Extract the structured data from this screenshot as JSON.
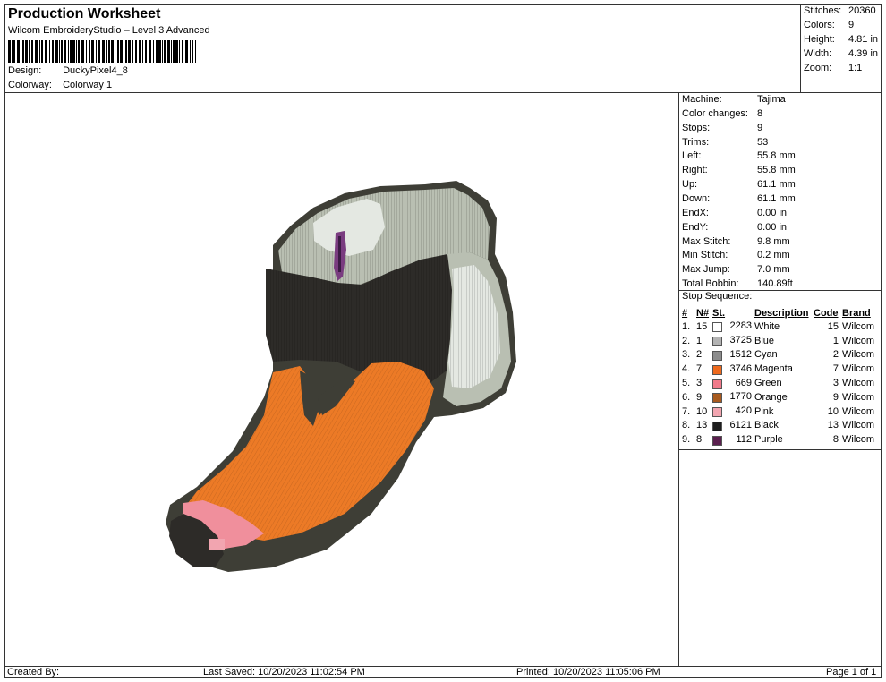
{
  "header": {
    "title": "Production Worksheet",
    "subtitle": "Wilcom EmbroideryStudio – Level 3 Advanced",
    "design_label": "Design:",
    "design_value": "DuckyPixel4_8",
    "colorway_label": "Colorway:",
    "colorway_value": "Colorway 1"
  },
  "stats": [
    {
      "k": "Stitches:",
      "v": "20360"
    },
    {
      "k": "Colors:",
      "v": "9"
    },
    {
      "k": "Height:",
      "v": "4.81 in"
    },
    {
      "k": "Width:",
      "v": "4.39 in"
    },
    {
      "k": "Zoom:",
      "v": "1:1"
    }
  ],
  "machine_info": [
    {
      "k": "Machine:",
      "v": "Tajima"
    },
    {
      "k": "Color changes:",
      "v": "8"
    },
    {
      "k": "Stops:",
      "v": "9"
    },
    {
      "k": "Trims:",
      "v": "53"
    },
    {
      "k": "Left:",
      "v": "55.8 mm"
    },
    {
      "k": "Right:",
      "v": "55.8 mm"
    },
    {
      "k": "Up:",
      "v": "61.1 mm"
    },
    {
      "k": "Down:",
      "v": "61.1 mm"
    },
    {
      "k": "EndX:",
      "v": "0.00 in"
    },
    {
      "k": "EndY:",
      "v": "0.00 in"
    },
    {
      "k": "Max Stitch:",
      "v": "9.8 mm"
    },
    {
      "k": "Min Stitch:",
      "v": "0.2 mm"
    },
    {
      "k": "Max Jump:",
      "v": "7.0 mm"
    },
    {
      "k": "Total Bobbin:",
      "v": "140.89ft"
    }
  ],
  "stop_sequence": {
    "title": "Stop Sequence:",
    "headers": [
      "#",
      "N#",
      "St.",
      "Description",
      "Code",
      "Brand"
    ],
    "rows": [
      {
        "n": "1.",
        "nn": "15",
        "color": "#ffffff",
        "st": "2283",
        "desc": "White",
        "code": "15",
        "brand": "Wilcom"
      },
      {
        "n": "2.",
        "nn": "1",
        "color": "#b3b3b3",
        "st": "3725",
        "desc": "Blue",
        "code": "1",
        "brand": "Wilcom"
      },
      {
        "n": "3.",
        "nn": "2",
        "color": "#8c8c8c",
        "st": "1512",
        "desc": "Cyan",
        "code": "2",
        "brand": "Wilcom"
      },
      {
        "n": "4.",
        "nn": "7",
        "color": "#ee6a1e",
        "st": "3746",
        "desc": "Magenta",
        "code": "7",
        "brand": "Wilcom"
      },
      {
        "n": "5.",
        "nn": "3",
        "color": "#f07a8a",
        "st": "669",
        "desc": "Green",
        "code": "3",
        "brand": "Wilcom"
      },
      {
        "n": "6.",
        "nn": "9",
        "color": "#a85a1e",
        "st": "1770",
        "desc": "Orange",
        "code": "9",
        "brand": "Wilcom"
      },
      {
        "n": "7.",
        "nn": "10",
        "color": "#f2a5b0",
        "st": "420",
        "desc": "Pink",
        "code": "10",
        "brand": "Wilcom"
      },
      {
        "n": "8.",
        "nn": "13",
        "color": "#1e1e1e",
        "st": "6121",
        "desc": "Black",
        "code": "13",
        "brand": "Wilcom"
      },
      {
        "n": "9.",
        "nn": "8",
        "color": "#5a1f4e",
        "st": "112",
        "desc": "Purple",
        "code": "8",
        "brand": "Wilcom"
      }
    ]
  },
  "footer": {
    "created_by": "Created By:",
    "last_saved": "Last Saved: 10/20/2023 11:02:54 PM",
    "printed": "Printed: 10/20/2023 11:05:06 PM",
    "page": "Page 1 of 1"
  },
  "design_colors": {
    "outline": "#3e3e36",
    "light_gray": "#b9bfb2",
    "white_gray": "#e4e8e2",
    "dark_band": "#2d2b28",
    "orange": "#ec7a26",
    "pink": "#f08f9c",
    "purple": "#7a3c80"
  }
}
